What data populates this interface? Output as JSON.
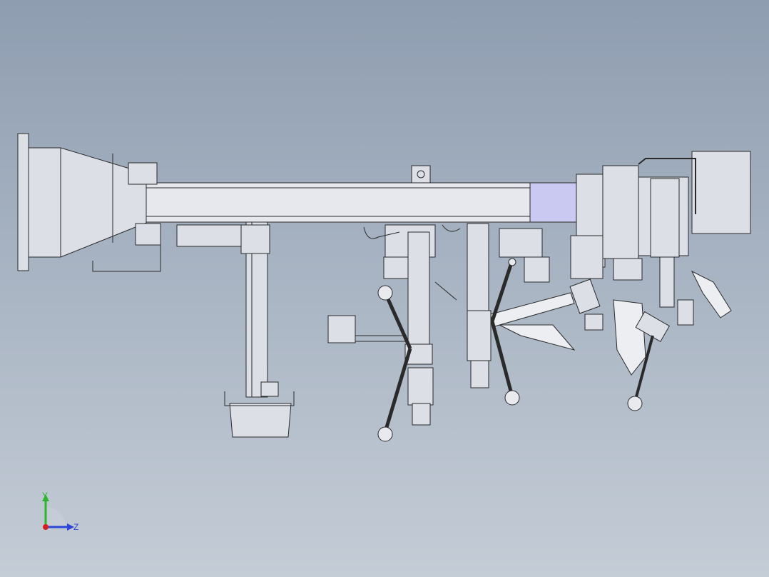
{
  "viewport": {
    "title": "",
    "colors": {
      "bg_top": "#8e9db0",
      "bg_bottom": "#c4ccd6",
      "part_fill": "#dcdfe6",
      "part_fill_light": "#eceef2",
      "edge": "#2a2a2a",
      "highlight": "#c9c9f2"
    }
  },
  "triad": {
    "y_label": "Y",
    "z_label": "Z",
    "y_color": "#2db52d",
    "z_color": "#2b46d8",
    "x_color": "#d42020"
  }
}
